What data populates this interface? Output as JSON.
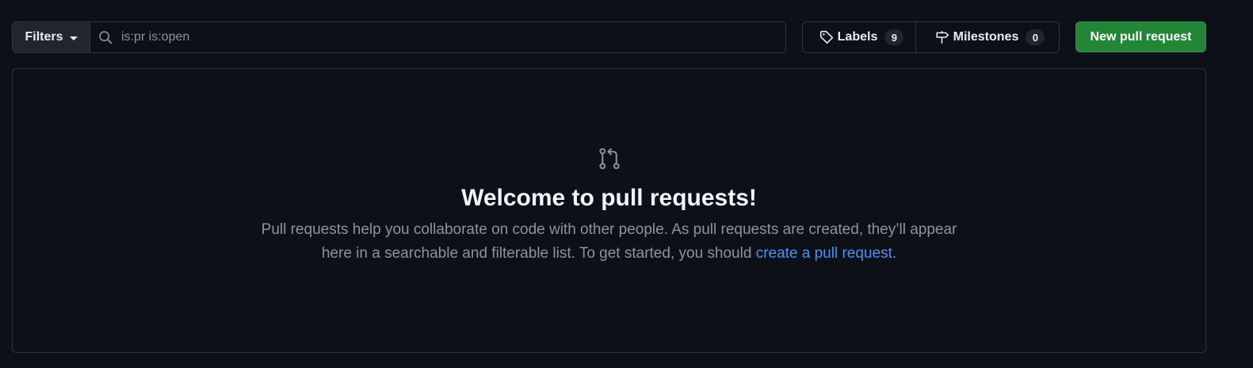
{
  "toolbar": {
    "filters_label": "Filters",
    "search_placeholder": "is:pr is:open",
    "labels": {
      "label": "Labels",
      "count": "9"
    },
    "milestones": {
      "label": "Milestones",
      "count": "0"
    },
    "new_pr_label": "New pull request"
  },
  "blankslate": {
    "title": "Welcome to pull requests!",
    "description_before": "Pull requests help you collaborate on code with other people. As pull requests are created, they’ll appear here in a searchable and filterable list. To get started, you should ",
    "link_text": "create a pull request",
    "description_after": "."
  },
  "colors": {
    "background": "#0d1117",
    "border": "#30363d",
    "primary_button": "#238636",
    "link": "#4493f8",
    "muted_text": "#8b949e"
  },
  "icons": [
    "caret-down-icon",
    "search-icon",
    "tag-icon",
    "milestone-icon",
    "git-pull-request-icon"
  ]
}
